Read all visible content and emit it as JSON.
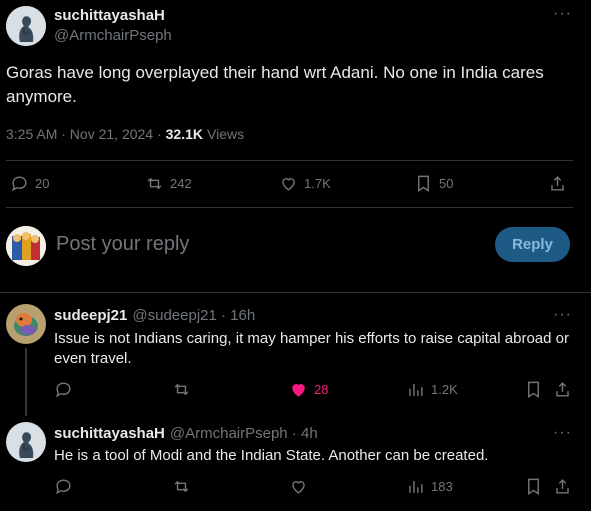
{
  "main_post": {
    "display_name": "suchittayashaH",
    "handle": "@ArmchairPseph",
    "text": "Goras have long overplayed their hand wrt Adani. No one in India cares anymore.",
    "time": "3:25 AM · Nov 21, 2024 ·",
    "views_count": "32.1K",
    "views_label": "Views",
    "replies": "20",
    "reposts": "242",
    "likes": "1.7K",
    "bookmarks": "50"
  },
  "composer": {
    "placeholder": "Post your reply",
    "reply_button": "Reply"
  },
  "replies": [
    {
      "display_name": "sudeepj21",
      "handle": "@sudeepj21 · 16h",
      "text": "Issue is not Indians caring, it may hamper his efforts to raise capital abroad or even travel.",
      "likes": "28",
      "views": "1.2K",
      "liked": true
    },
    {
      "display_name": "suchittayashaH",
      "handle": "@ArmchairPseph · 4h",
      "text": "He is a tool of Modi and the Indian State. Another can be created.",
      "likes": "",
      "views": "183",
      "liked": false
    }
  ],
  "icons": {
    "more": "more-icon",
    "reply": "reply-icon",
    "repost": "repost-icon",
    "like": "heart-icon",
    "views": "views-icon",
    "bookmark": "bookmark-icon",
    "share": "share-icon"
  },
  "colors": {
    "background": "#000000",
    "text": "#e7e9ea",
    "muted": "#71767b",
    "like_active": "#f91880",
    "reply_button": "#1d5a85"
  }
}
